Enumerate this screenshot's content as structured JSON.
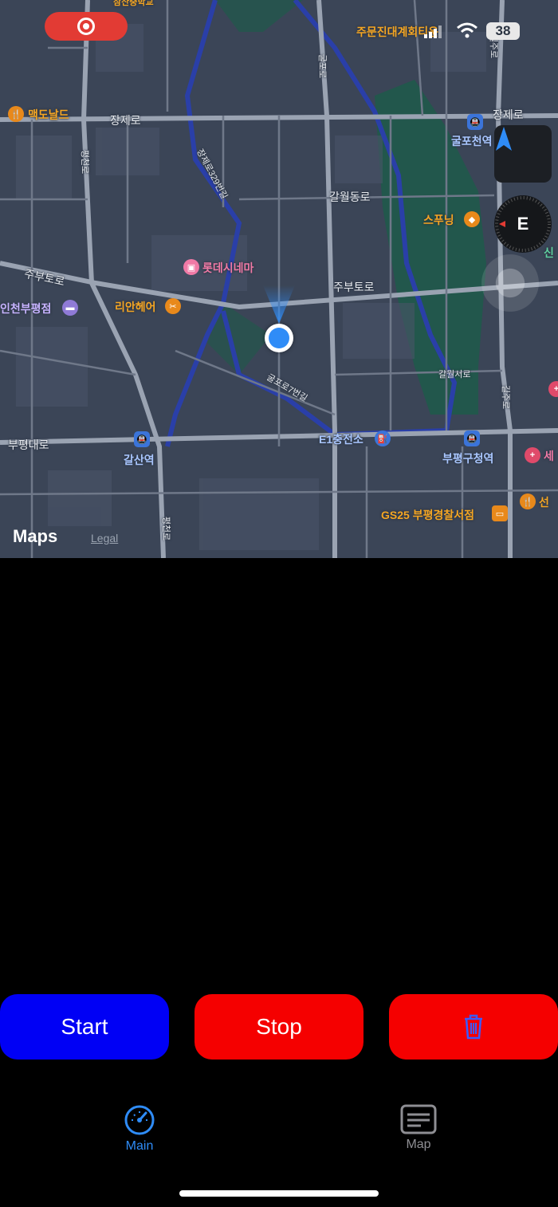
{
  "status_bar": {
    "battery": "38",
    "icons": [
      "record-icon",
      "signal-icon",
      "wifi-icon",
      "battery-icon"
    ]
  },
  "map": {
    "labels": {
      "top_school": "삼산중학교",
      "jumun": "주문진대계회티운",
      "mcdonalds": "맥도날드",
      "jangje_left": "장제로",
      "jangje_right": "장제로",
      "gulpo_station_top": "굴포천역",
      "galwol_dong": "갈월동로",
      "spring": "스푸닝",
      "lotte_cinema": "롯데시네마",
      "jubu_left": "주부토로",
      "jubu_right": "주부토로",
      "incheon_bupyeong": "인천부평점",
      "rian_heoeo": "리안헤어",
      "galwol_seo": "갈월서로",
      "gulpo_7": "굴포로7번길",
      "jangje_329": "장제로329번길",
      "gulpo_road": "굴포로",
      "e1_station": "E1충전소",
      "bupyeong_daero": "부평대로",
      "galsan_station": "갈산역",
      "bupyeong_gu_station": "부평구청역",
      "gs25": "GS25 부평경찰서점",
      "bupyeong_ro": "평천로",
      "bupyeong_ro_2": "평천로",
      "gilju": "길주로",
      "gilju_2": "길주로",
      "sin": "신",
      "se": "세",
      "seon": "선"
    },
    "compass_heading": "E",
    "logo": "Maps",
    "legal": "Legal"
  },
  "controls": {
    "start_label": "Start",
    "stop_label": "Stop",
    "delete_icon": "trash-icon"
  },
  "tabbar": {
    "tabs": [
      {
        "label": "Main",
        "icon": "speedometer-icon",
        "active": true
      },
      {
        "label": "Map",
        "icon": "map-list-icon",
        "active": false
      }
    ]
  },
  "colors": {
    "start": "#0000f5",
    "stop": "#f50000",
    "active_tab": "#2f8cf7",
    "inactive_tab": "#8e8e93",
    "map_bg": "#3b4557",
    "park": "#1f5a4a",
    "river": "#2a3fa8"
  }
}
